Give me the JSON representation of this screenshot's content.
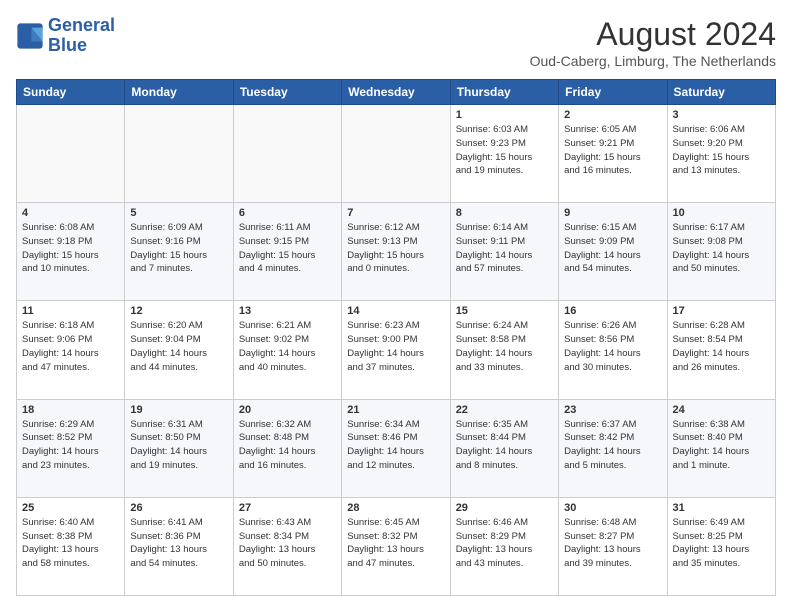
{
  "logo": {
    "line1": "General",
    "line2": "Blue"
  },
  "header": {
    "month": "August 2024",
    "location": "Oud-Caberg, Limburg, The Netherlands"
  },
  "weekdays": [
    "Sunday",
    "Monday",
    "Tuesday",
    "Wednesday",
    "Thursday",
    "Friday",
    "Saturday"
  ],
  "weeks": [
    [
      {
        "day": "",
        "info": ""
      },
      {
        "day": "",
        "info": ""
      },
      {
        "day": "",
        "info": ""
      },
      {
        "day": "",
        "info": ""
      },
      {
        "day": "1",
        "info": "Sunrise: 6:03 AM\nSunset: 9:23 PM\nDaylight: 15 hours\nand 19 minutes."
      },
      {
        "day": "2",
        "info": "Sunrise: 6:05 AM\nSunset: 9:21 PM\nDaylight: 15 hours\nand 16 minutes."
      },
      {
        "day": "3",
        "info": "Sunrise: 6:06 AM\nSunset: 9:20 PM\nDaylight: 15 hours\nand 13 minutes."
      }
    ],
    [
      {
        "day": "4",
        "info": "Sunrise: 6:08 AM\nSunset: 9:18 PM\nDaylight: 15 hours\nand 10 minutes."
      },
      {
        "day": "5",
        "info": "Sunrise: 6:09 AM\nSunset: 9:16 PM\nDaylight: 15 hours\nand 7 minutes."
      },
      {
        "day": "6",
        "info": "Sunrise: 6:11 AM\nSunset: 9:15 PM\nDaylight: 15 hours\nand 4 minutes."
      },
      {
        "day": "7",
        "info": "Sunrise: 6:12 AM\nSunset: 9:13 PM\nDaylight: 15 hours\nand 0 minutes."
      },
      {
        "day": "8",
        "info": "Sunrise: 6:14 AM\nSunset: 9:11 PM\nDaylight: 14 hours\nand 57 minutes."
      },
      {
        "day": "9",
        "info": "Sunrise: 6:15 AM\nSunset: 9:09 PM\nDaylight: 14 hours\nand 54 minutes."
      },
      {
        "day": "10",
        "info": "Sunrise: 6:17 AM\nSunset: 9:08 PM\nDaylight: 14 hours\nand 50 minutes."
      }
    ],
    [
      {
        "day": "11",
        "info": "Sunrise: 6:18 AM\nSunset: 9:06 PM\nDaylight: 14 hours\nand 47 minutes."
      },
      {
        "day": "12",
        "info": "Sunrise: 6:20 AM\nSunset: 9:04 PM\nDaylight: 14 hours\nand 44 minutes."
      },
      {
        "day": "13",
        "info": "Sunrise: 6:21 AM\nSunset: 9:02 PM\nDaylight: 14 hours\nand 40 minutes."
      },
      {
        "day": "14",
        "info": "Sunrise: 6:23 AM\nSunset: 9:00 PM\nDaylight: 14 hours\nand 37 minutes."
      },
      {
        "day": "15",
        "info": "Sunrise: 6:24 AM\nSunset: 8:58 PM\nDaylight: 14 hours\nand 33 minutes."
      },
      {
        "day": "16",
        "info": "Sunrise: 6:26 AM\nSunset: 8:56 PM\nDaylight: 14 hours\nand 30 minutes."
      },
      {
        "day": "17",
        "info": "Sunrise: 6:28 AM\nSunset: 8:54 PM\nDaylight: 14 hours\nand 26 minutes."
      }
    ],
    [
      {
        "day": "18",
        "info": "Sunrise: 6:29 AM\nSunset: 8:52 PM\nDaylight: 14 hours\nand 23 minutes."
      },
      {
        "day": "19",
        "info": "Sunrise: 6:31 AM\nSunset: 8:50 PM\nDaylight: 14 hours\nand 19 minutes."
      },
      {
        "day": "20",
        "info": "Sunrise: 6:32 AM\nSunset: 8:48 PM\nDaylight: 14 hours\nand 16 minutes."
      },
      {
        "day": "21",
        "info": "Sunrise: 6:34 AM\nSunset: 8:46 PM\nDaylight: 14 hours\nand 12 minutes."
      },
      {
        "day": "22",
        "info": "Sunrise: 6:35 AM\nSunset: 8:44 PM\nDaylight: 14 hours\nand 8 minutes."
      },
      {
        "day": "23",
        "info": "Sunrise: 6:37 AM\nSunset: 8:42 PM\nDaylight: 14 hours\nand 5 minutes."
      },
      {
        "day": "24",
        "info": "Sunrise: 6:38 AM\nSunset: 8:40 PM\nDaylight: 14 hours\nand 1 minute."
      }
    ],
    [
      {
        "day": "25",
        "info": "Sunrise: 6:40 AM\nSunset: 8:38 PM\nDaylight: 13 hours\nand 58 minutes."
      },
      {
        "day": "26",
        "info": "Sunrise: 6:41 AM\nSunset: 8:36 PM\nDaylight: 13 hours\nand 54 minutes."
      },
      {
        "day": "27",
        "info": "Sunrise: 6:43 AM\nSunset: 8:34 PM\nDaylight: 13 hours\nand 50 minutes."
      },
      {
        "day": "28",
        "info": "Sunrise: 6:45 AM\nSunset: 8:32 PM\nDaylight: 13 hours\nand 47 minutes."
      },
      {
        "day": "29",
        "info": "Sunrise: 6:46 AM\nSunset: 8:29 PM\nDaylight: 13 hours\nand 43 minutes."
      },
      {
        "day": "30",
        "info": "Sunrise: 6:48 AM\nSunset: 8:27 PM\nDaylight: 13 hours\nand 39 minutes."
      },
      {
        "day": "31",
        "info": "Sunrise: 6:49 AM\nSunset: 8:25 PM\nDaylight: 13 hours\nand 35 minutes."
      }
    ]
  ]
}
